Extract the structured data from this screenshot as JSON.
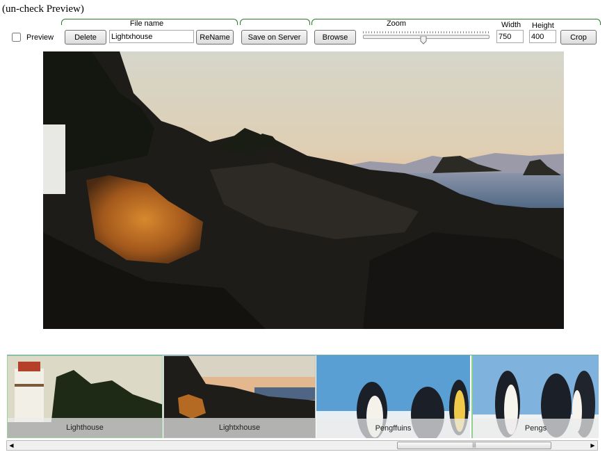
{
  "hint_text": "(un-check Preview)",
  "toolbar": {
    "preview_label": "Preview",
    "preview_checked": false,
    "filename_group_label": "File name",
    "zoom_group_label": "Zoom",
    "width_label": "Width",
    "height_label": "Height",
    "delete_label": "Delete",
    "filename_value": "Lightxhouse",
    "rename_label": "ReName",
    "save_label": "Save on Server",
    "browse_label": "Browse",
    "width_value": "750",
    "height_value": "400",
    "crop_label": "Crop",
    "zoom_level": 0.48
  },
  "thumbnails": [
    {
      "caption": "Lighthouse"
    },
    {
      "caption": "Lightxhouse"
    },
    {
      "caption": "Pengffuins"
    },
    {
      "caption": "Pengs"
    }
  ],
  "colors": {
    "group_border": "#2a7a2a",
    "sky_top": "#d8d9cf",
    "sky_bottom": "#e9b68a",
    "sea": "#5e7490",
    "rock": "#1c1a18"
  }
}
